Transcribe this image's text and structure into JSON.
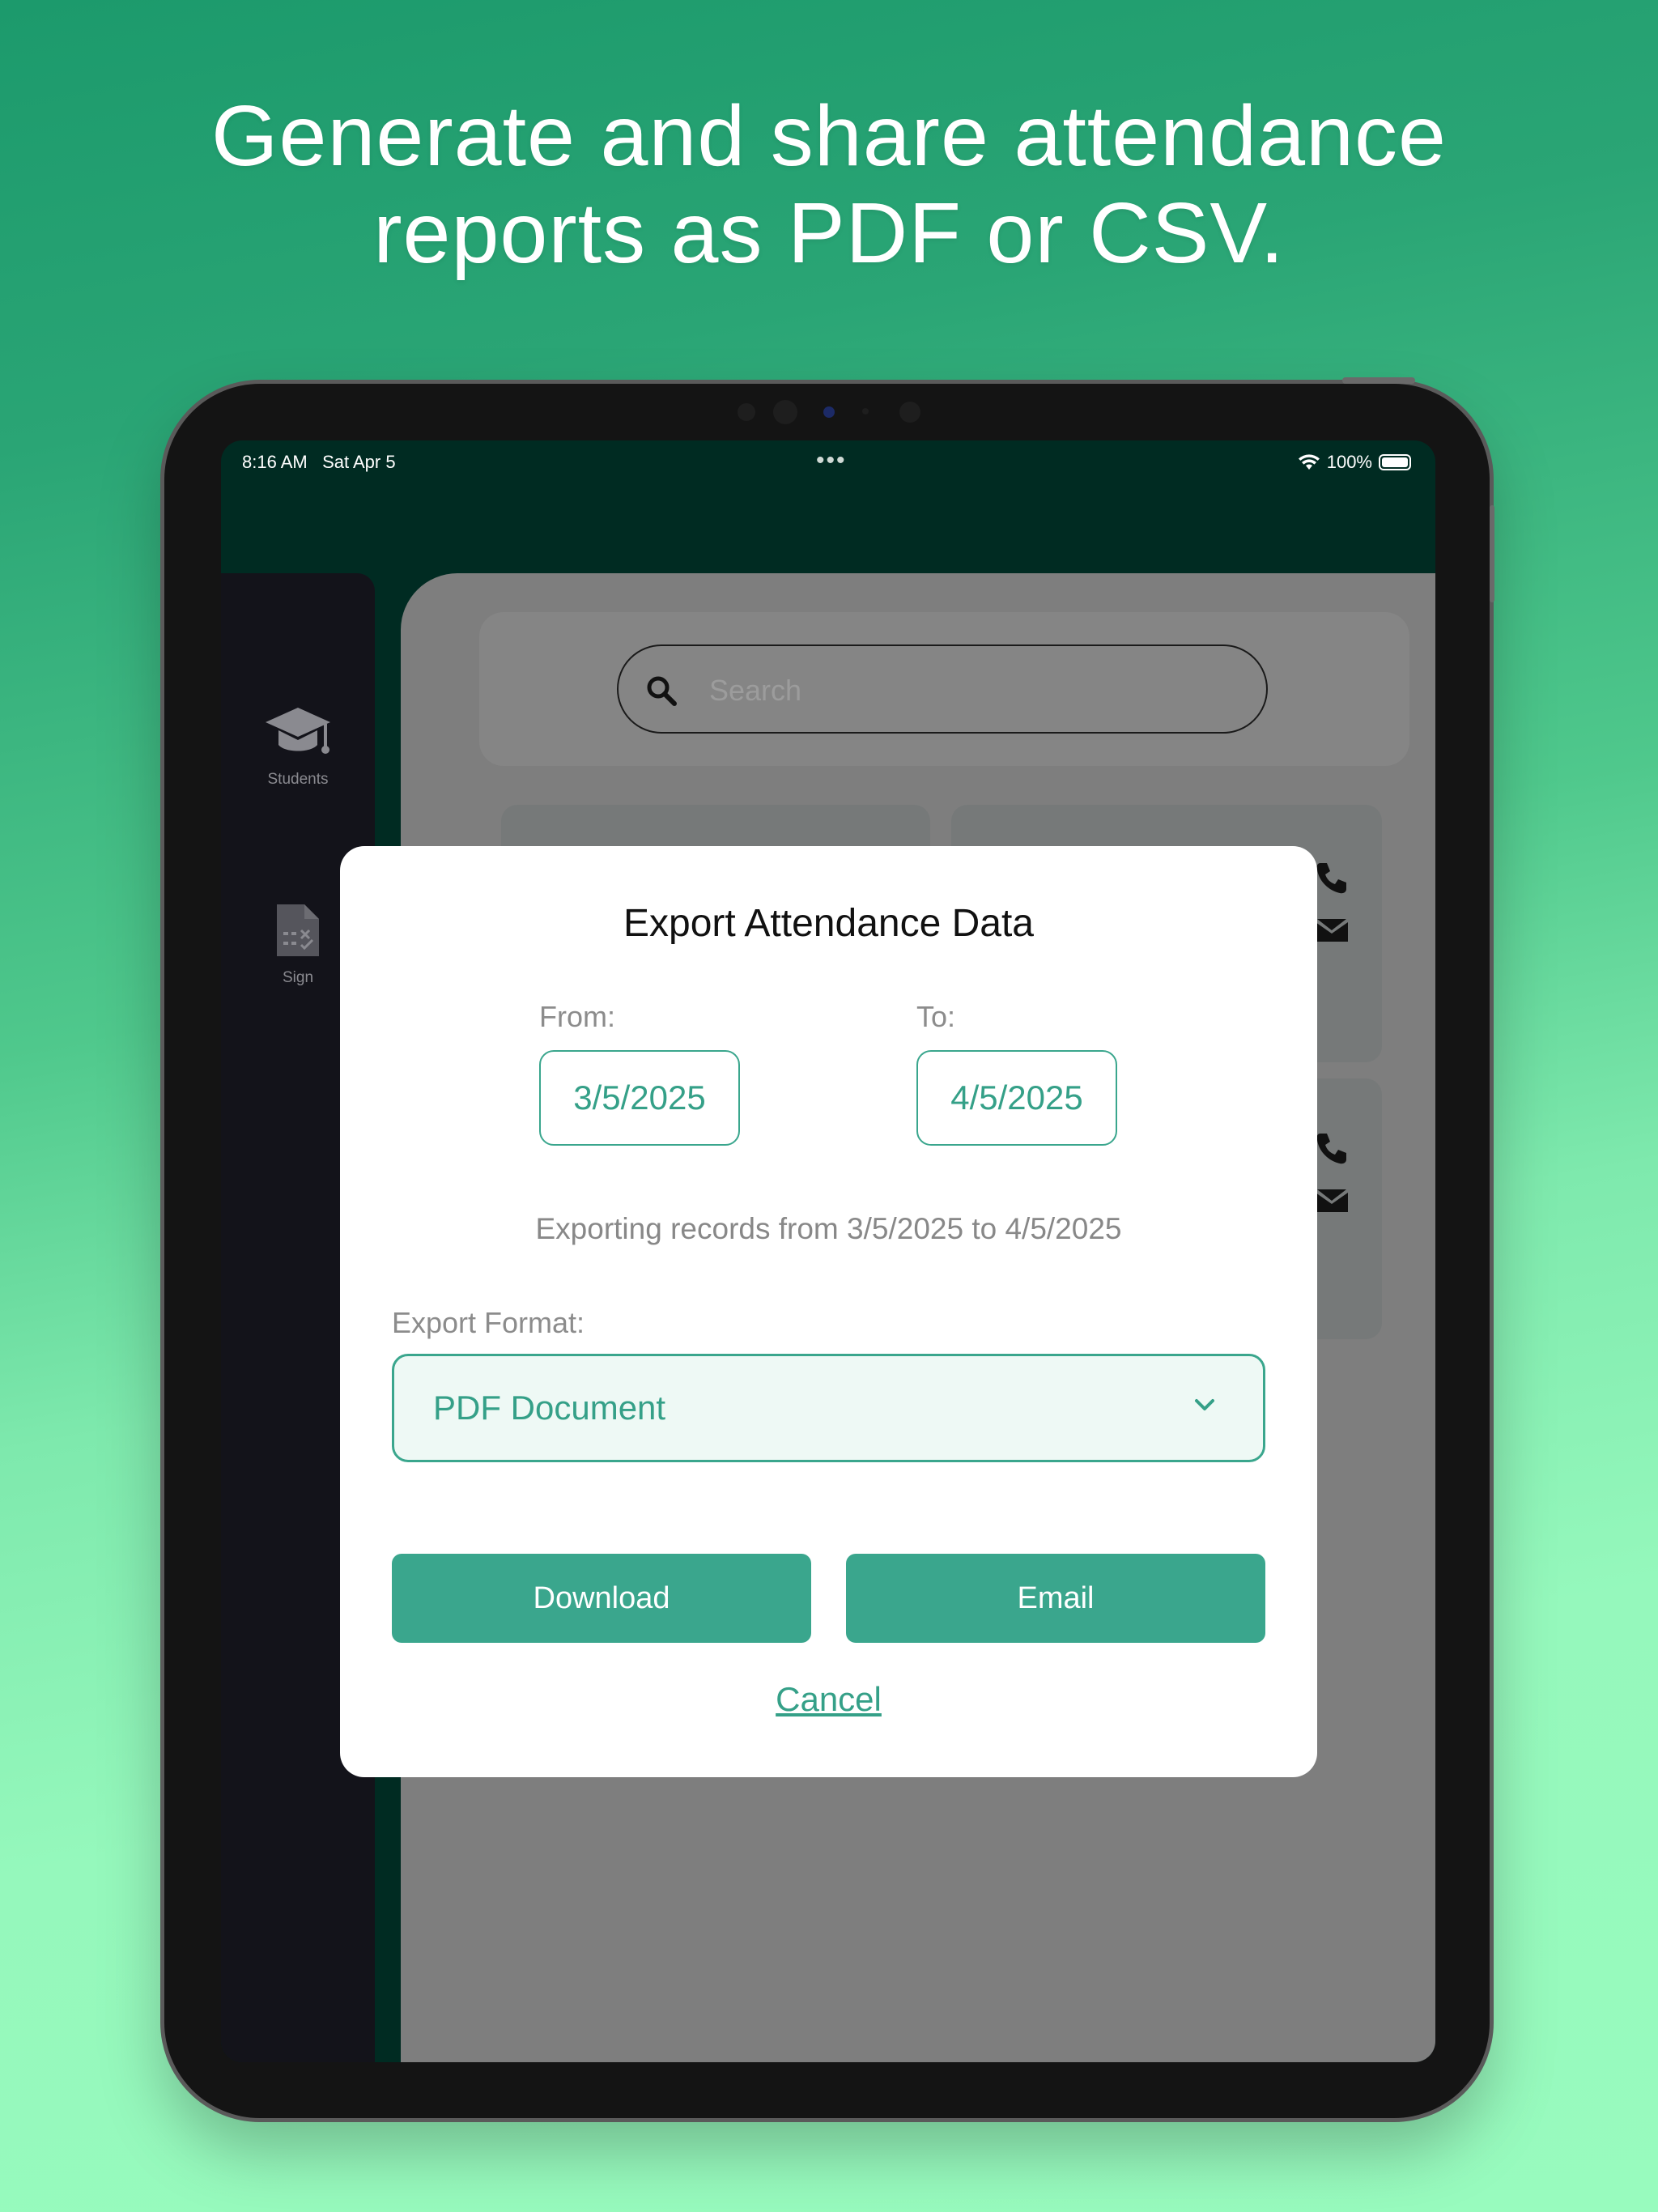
{
  "headline": {
    "line1": "Generate and share attendance",
    "line2": "reports as PDF or CSV."
  },
  "status_bar": {
    "time": "8:16 AM",
    "date": "Sat Apr 5",
    "battery": "100%"
  },
  "sidebar": {
    "items": [
      {
        "label": "Students",
        "icon": "graduation-cap-icon"
      },
      {
        "label": "Sign",
        "icon": "document-sign-icon"
      }
    ]
  },
  "search": {
    "placeholder": "Search"
  },
  "modal": {
    "title": "Export Attendance Data",
    "from_label": "From:",
    "from_value": "3/5/2025",
    "to_label": "To:",
    "to_value": "4/5/2025",
    "range_text": "Exporting records from 3/5/2025 to 4/5/2025",
    "format_label": "Export Format:",
    "format_value": "PDF Document",
    "download_label": "Download",
    "email_label": "Email",
    "cancel_label": "Cancel"
  },
  "colors": {
    "accent": "#3aa68d",
    "header": "#002b22",
    "sidebar": "#13131a"
  }
}
